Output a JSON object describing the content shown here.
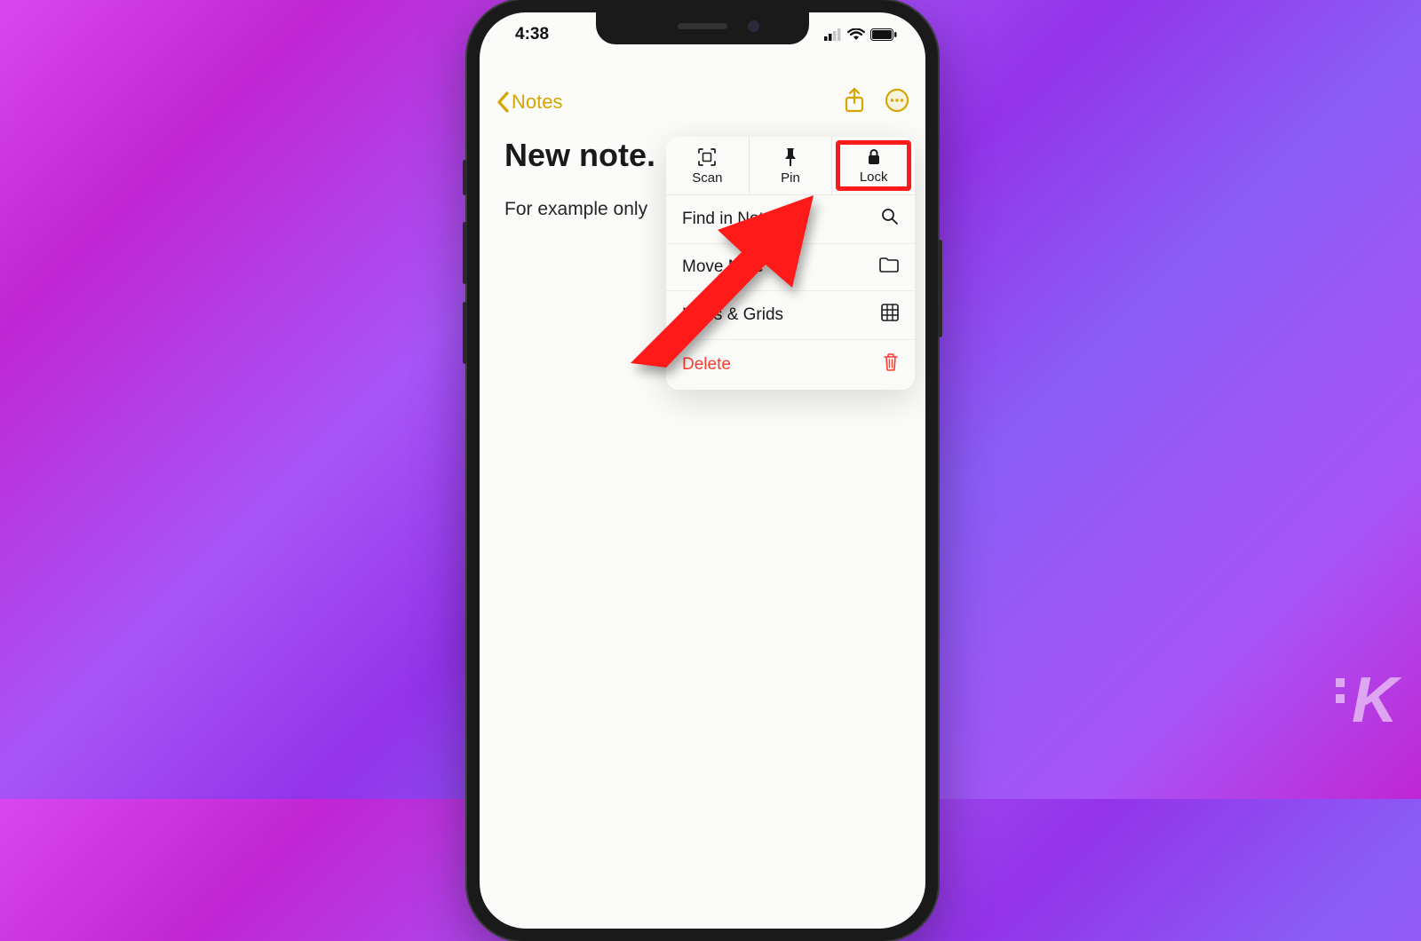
{
  "status": {
    "time": "4:38"
  },
  "nav": {
    "back_label": "Notes"
  },
  "note": {
    "title": "New note.",
    "body": "For example only"
  },
  "menu": {
    "top": {
      "scan": "Scan",
      "pin": "Pin",
      "lock": "Lock"
    },
    "find": "Find in Note",
    "move": "Move Note",
    "lines": "Lines & Grids",
    "delete": "Delete"
  },
  "colors": {
    "accent": "#d6a500",
    "highlight": "#ff1a1a",
    "delete": "#ff3b30"
  }
}
